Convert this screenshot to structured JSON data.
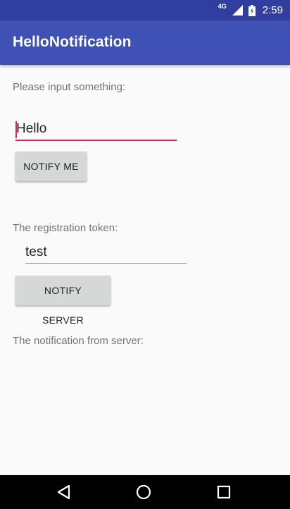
{
  "status_bar": {
    "network_type": "4G",
    "time": "2:59",
    "icons": [
      "signal-icon",
      "battery-icon"
    ]
  },
  "app_bar": {
    "title": "HelloNotification"
  },
  "main": {
    "input_label": "Please input something:",
    "input_value": "Hello",
    "notify_me_button": "NOTIFY ME",
    "token_label": "The registration token:",
    "token_value": "test",
    "notify_server_button": "NOTIFY SERVER",
    "notification_label": "The notification from server:"
  },
  "nav_bar": {
    "icons": [
      "back-icon",
      "home-icon",
      "recents-icon"
    ]
  },
  "colors": {
    "primary": "#3f51b5",
    "primary_dark": "#303f9f",
    "accent": "#e91e63",
    "button": "#d6d7d7"
  }
}
